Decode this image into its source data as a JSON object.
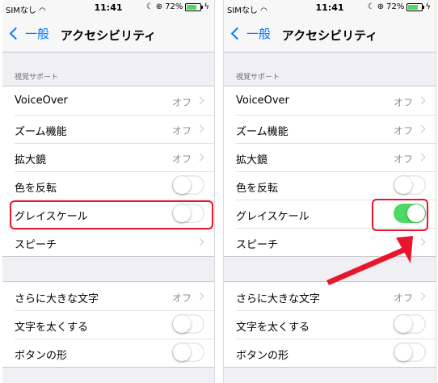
{
  "colors": {
    "accent": "#007aff",
    "toggle_on": "#4cd964",
    "highlight": "#e8162c"
  },
  "status_bar": {
    "carrier": "SIMなし",
    "time": "11:41",
    "battery": "72%"
  },
  "nav": {
    "back_label": "一般",
    "title": "アクセシビリティ"
  },
  "section_header": "視覚サポート",
  "rows": {
    "voiceover": {
      "label": "VoiceOver",
      "value": "オフ"
    },
    "zoom": {
      "label": "ズーム機能",
      "value": "オフ"
    },
    "magnifier": {
      "label": "拡大鏡",
      "value": "オフ"
    },
    "invert": {
      "label": "色を反転"
    },
    "grayscale": {
      "label": "グレイスケール"
    },
    "speech": {
      "label": "スピーチ"
    },
    "larger_text": {
      "label": "さらに大きな文字",
      "value": "オフ"
    },
    "bold_text": {
      "label": "文字を太くする"
    },
    "button_shapes": {
      "label": "ボタンの形"
    }
  },
  "screens": {
    "left": {
      "grayscale_on": false
    },
    "right": {
      "grayscale_on": true
    }
  }
}
